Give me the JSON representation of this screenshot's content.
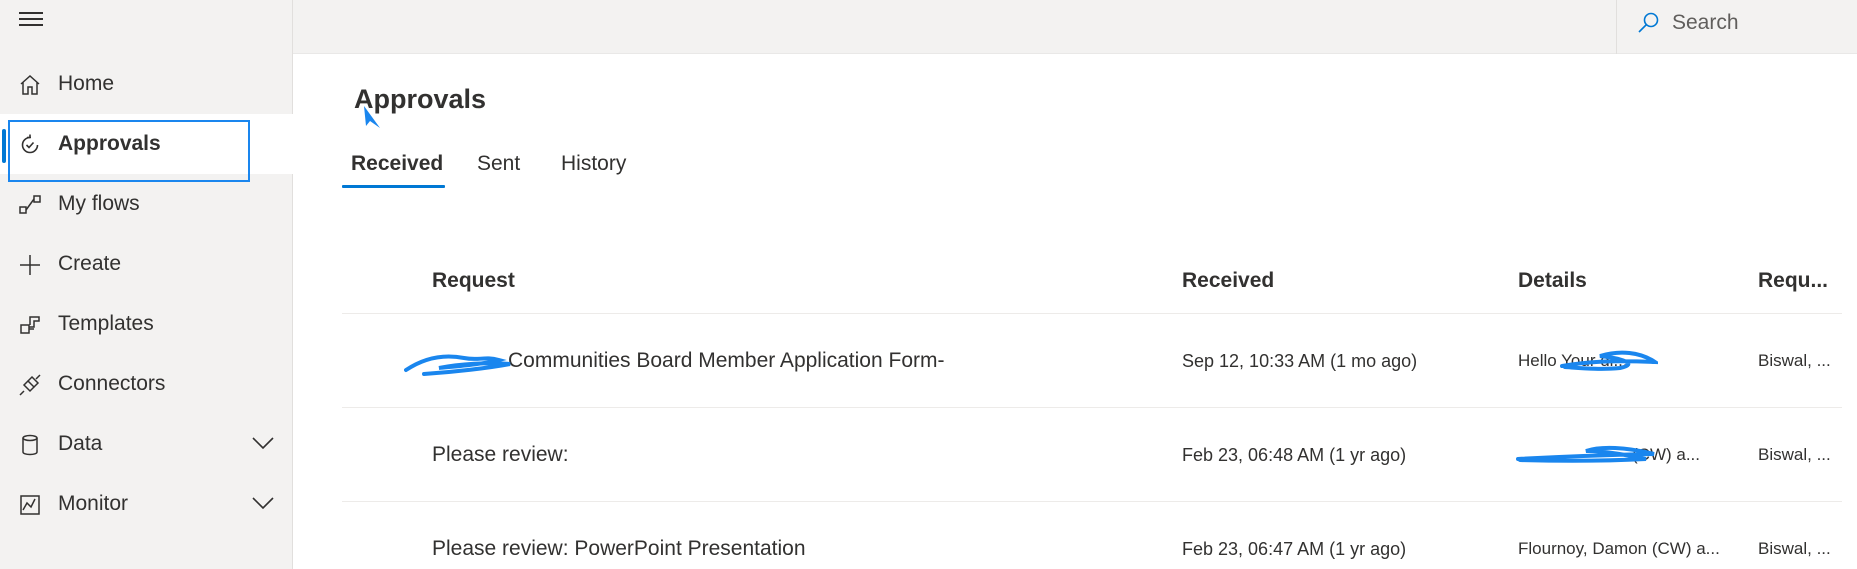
{
  "nav": {
    "items": [
      {
        "label": "Home",
        "icon": "home-icon"
      },
      {
        "label": "Approvals",
        "icon": "approvals-icon",
        "selected": true
      },
      {
        "label": "My flows",
        "icon": "flows-icon"
      },
      {
        "label": "Create",
        "icon": "plus-icon"
      },
      {
        "label": "Templates",
        "icon": "templates-icon"
      },
      {
        "label": "Connectors",
        "icon": "connectors-icon"
      },
      {
        "label": "Data",
        "icon": "database-icon",
        "expandable": true
      },
      {
        "label": "Monitor",
        "icon": "monitor-icon",
        "expandable": true
      }
    ]
  },
  "search": {
    "placeholder": "Search"
  },
  "page": {
    "title": "Approvals"
  },
  "tabs": [
    {
      "label": "Received",
      "active": true
    },
    {
      "label": "Sent"
    },
    {
      "label": "History"
    }
  ],
  "table": {
    "columns": [
      "Request",
      "Received",
      "Details",
      "Requ..."
    ],
    "rows": [
      {
        "request": "Communities Board Member Application Form-",
        "received": "Sep 12, 10:33 AM (1 mo ago)",
        "details": "Hello Your di...",
        "requestor": "Biswal, ..."
      },
      {
        "request": "Please review:",
        "received": "Feb 23, 06:48 AM (1 yr ago)",
        "details": "(CW) a...",
        "requestor": "Biswal, ..."
      },
      {
        "request": "Please review: PowerPoint Presentation",
        "received": "Feb 23, 06:47 AM (1 yr ago)",
        "details": "Flournoy, Damon (CW) a...",
        "requestor": "Biswal, ..."
      }
    ]
  },
  "colors": {
    "accent": "#0078d4",
    "annotation": "#1a86ee"
  }
}
